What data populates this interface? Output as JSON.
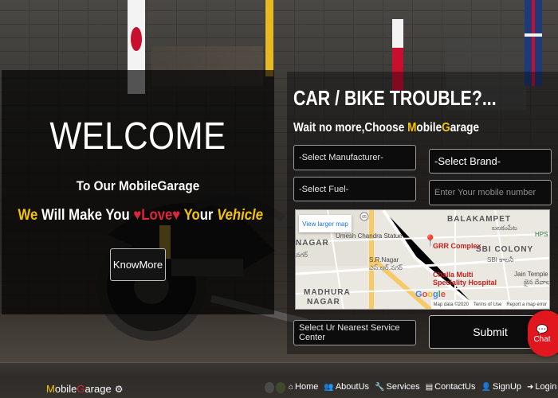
{
  "hero": {
    "welcome": "WELCOME",
    "subtitle": "To Our MobileGarage",
    "tagline": {
      "we": "We",
      "will_make_you": " Will Make You ",
      "heart1": "♥",
      "love": "Love",
      "heart2": "♥",
      "yo": " Yo",
      "ur": "ur ",
      "vehicle": "Vehicle"
    },
    "knowmore_label": "KnowMore"
  },
  "booking": {
    "title": "CAR / BIKE TROUBLE?...",
    "subtitle": {
      "part1": "Wait no more,Choose ",
      "m": "M",
      "obile": "obile",
      "g": "G",
      "arage": "arage"
    },
    "manufacturer_value": "-Select Manufacturer-",
    "brand_value": "-Select Brand-",
    "fuel_value": "-Select Fuel-",
    "mobile_placeholder": "Enter Your mobile number",
    "service_center_value": "Select Ur Nearest Service Center",
    "submit_label": "Submit"
  },
  "map": {
    "view_larger": "View larger map",
    "labels": {
      "balakampet": "BALAKAMPET",
      "balakampet_te": "బలకంపేట",
      "hps": "HPS p",
      "nagar": "NAGAR",
      "nagar_te": "నగర్",
      "umesh": "Umesh Chandra Statue",
      "grr": "GRR Complex",
      "sr_nagar": "S.R.Nagar",
      "sr_nagar_te": "ఎస్.ఆర్.నగర్",
      "sbi_colony": "SBI COLONY",
      "sbi_colony_te": "SBI కాలనీ",
      "challa": "Challa Multi",
      "challa2": "Speciality Hospital",
      "jain": "Jain Temple",
      "jain_te": "జైన దేవాలయం",
      "madhura": "MADHURA",
      "nagar2": "NAGAR",
      "road_65": "65"
    },
    "google": [
      "G",
      "o",
      "o",
      "g",
      "l",
      "e"
    ],
    "footer": [
      "Map data ©2020",
      "Terms of Use",
      "Report a map error"
    ]
  },
  "chat": {
    "icon": "💬",
    "label": "Chat"
  },
  "footer": {
    "brand": {
      "m": "M",
      "obile": "obile",
      "g": "G",
      "arage": "arage",
      "gear": "⚙"
    },
    "nav": [
      {
        "icon": "⌂",
        "label": "Home"
      },
      {
        "icon": "👥",
        "label": "AboutUs"
      },
      {
        "icon": "🔧",
        "label": "Services"
      },
      {
        "icon": "▤",
        "label": "ContactUs"
      },
      {
        "icon": "👤",
        "label": "SignUp"
      },
      {
        "icon": "➜",
        "label": "Login"
      }
    ]
  },
  "colors": {
    "accent_yellow": "#f5c400",
    "accent_red": "#e0243a",
    "chat_red": "#e0171f"
  }
}
